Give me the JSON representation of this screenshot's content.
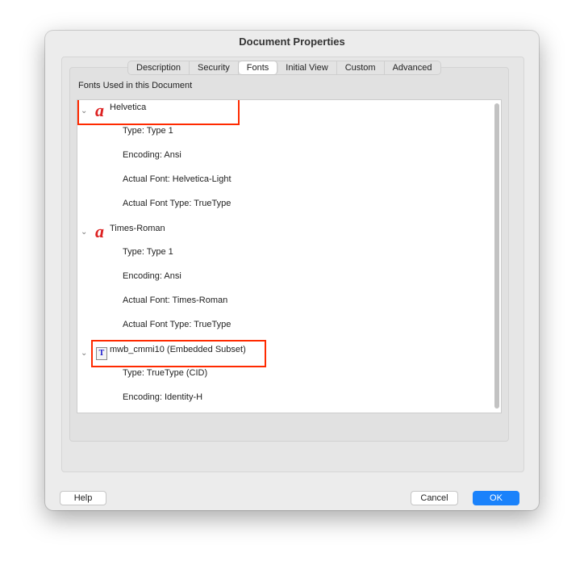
{
  "window": {
    "title": "Document Properties"
  },
  "tabs": [
    {
      "label": "Description"
    },
    {
      "label": "Security"
    },
    {
      "label": "Fonts",
      "selected": true
    },
    {
      "label": "Initial View"
    },
    {
      "label": "Custom"
    },
    {
      "label": "Advanced"
    }
  ],
  "fonts_label": "Fonts Used in this Document",
  "fonts": [
    {
      "name": "Helvetica",
      "icon": "type1-font-icon",
      "highlighted": true,
      "props": [
        "Type: Type 1",
        "Encoding: Ansi",
        "Actual Font: Helvetica-Light",
        "Actual Font Type: TrueType"
      ]
    },
    {
      "name": "Times-Roman",
      "icon": "type1-font-icon",
      "highlighted": false,
      "props": [
        "Type: Type 1",
        "Encoding: Ansi",
        "Actual Font: Times-Roman",
        "Actual Font Type: TrueType"
      ]
    },
    {
      "name": "mwb_cmmi10 (Embedded Subset)",
      "icon": "truetype-font-icon",
      "highlighted": true,
      "props": [
        "Type: TrueType (CID)",
        "Encoding: Identity-H"
      ]
    }
  ],
  "buttons": {
    "help": "Help",
    "cancel": "Cancel",
    "ok": "OK"
  },
  "colors": {
    "highlight": "#ff2a00",
    "accent": "#1a82fb"
  }
}
